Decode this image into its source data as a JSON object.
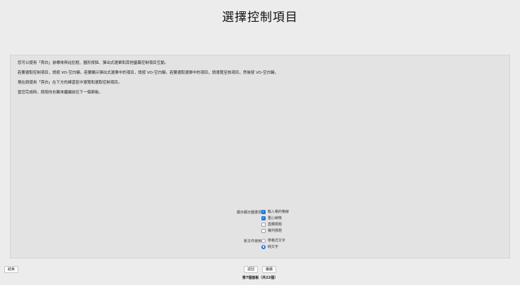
{
  "title": "選擇控制項目",
  "paragraphs": [
    "您可以使用「旁白」游標來與註記框、圓形按鈕、彈出式選單和其他螢幕控制項目互動。",
    "若要選取控制項目，請按 VO-空白鍵。若要顯示彈出式選單中的項目，請按 VO-空白鍵。若要選取選單中的項目，請導覽至該項目，然後按 VO-空白鍵。",
    "現在請使用「旁白」在下方的練習區中導覽和選取控制項目。",
    "當您完成時，請按向右鍵來繼續前往下一個面板。"
  ],
  "display_group": {
    "label": "顯示顯示器選項：",
    "options": [
      {
        "label": "輸入格的格線",
        "checked": true
      },
      {
        "label": "重心線條",
        "checked": true
      },
      {
        "label": "直欄標題",
        "checked": false
      },
      {
        "label": "橫列標題",
        "checked": false
      }
    ]
  },
  "doc_group": {
    "label": "新文件使用：",
    "options": [
      {
        "label": "帶格式文字",
        "selected": false
      },
      {
        "label": "純文字",
        "selected": true
      }
    ]
  },
  "buttons": {
    "end": "結束",
    "back": "返回",
    "continue": "繼續"
  },
  "footer": "第7個面板（共22個）",
  "colors": {
    "accent": "#1a73e8",
    "background": "#ececec",
    "panel": "#e3e3e3"
  }
}
